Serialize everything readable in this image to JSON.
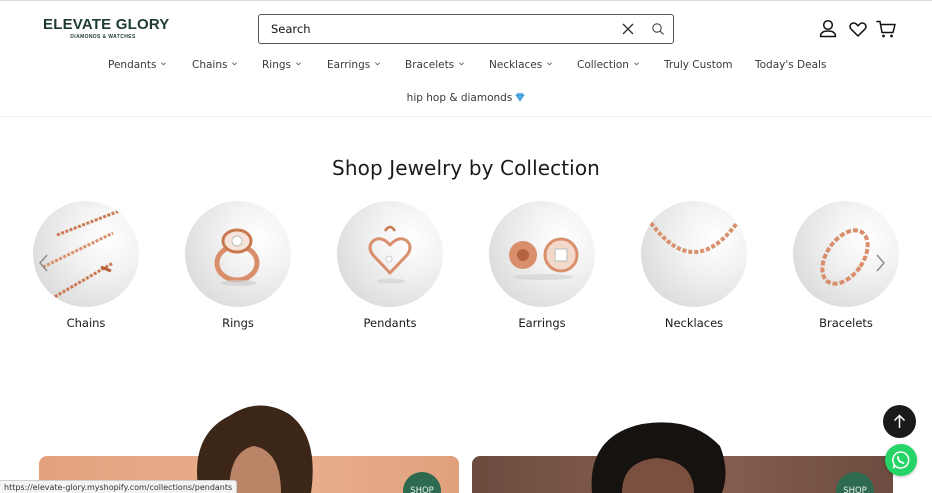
{
  "header": {
    "logo_main": "ELEVATE GLORY",
    "logo_sub": "DIAMONDS & WATCHES",
    "search_placeholder": "Search"
  },
  "nav": {
    "items": [
      {
        "label": "Pendants",
        "has_dropdown": true
      },
      {
        "label": "Chains",
        "has_dropdown": true
      },
      {
        "label": "Rings",
        "has_dropdown": true
      },
      {
        "label": "Earrings",
        "has_dropdown": true
      },
      {
        "label": "Bracelets",
        "has_dropdown": true
      },
      {
        "label": "Necklaces",
        "has_dropdown": true
      },
      {
        "label": "Collection",
        "has_dropdown": true
      },
      {
        "label": "Truly Custom",
        "has_dropdown": false
      },
      {
        "label": "Today's Deals",
        "has_dropdown": false
      }
    ],
    "second_row": "hip hop & diamonds",
    "second_row_icon": "gem-icon"
  },
  "collections": {
    "title": "Shop Jewelry by Collection",
    "items": [
      {
        "label": "Chains"
      },
      {
        "label": "Rings"
      },
      {
        "label": "Pendants"
      },
      {
        "label": "Earrings"
      },
      {
        "label": "Necklaces"
      },
      {
        "label": "Bracelets"
      }
    ]
  },
  "banners": [
    {
      "shop_label": "SHOP"
    },
    {
      "shop_label": "SHOP"
    }
  ],
  "status_bar": {
    "url": "https://elevate-glory.myshopify.com/collections/pendants"
  },
  "colors": {
    "brand": "#1d3b2e",
    "rose_gold": "#d98e6c",
    "shop_badge": "#2d6a4f",
    "whatsapp": "#25d366"
  }
}
